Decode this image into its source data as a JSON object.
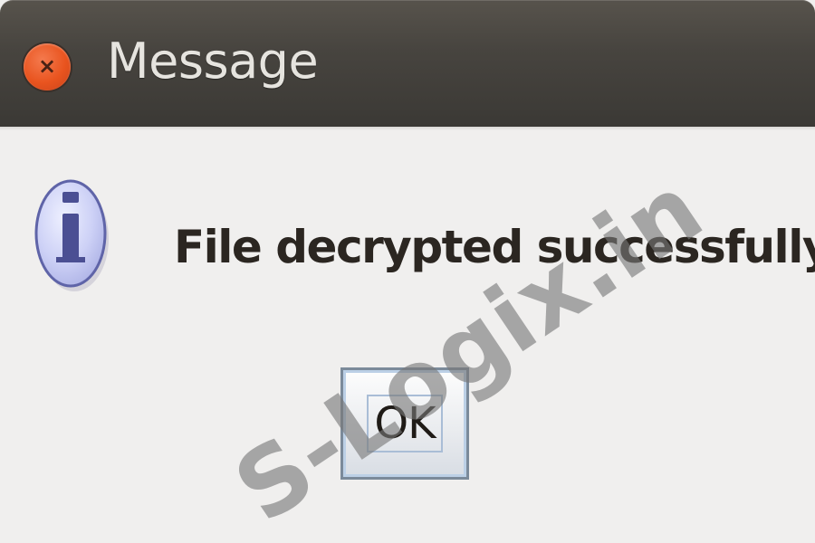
{
  "window": {
    "title": "Message",
    "close_glyph": "×",
    "colors": {
      "titlebar": "#47443f",
      "close_button": "#e9541f",
      "background": "#f0efee"
    }
  },
  "dialog": {
    "icon": "information-icon",
    "message": "File decrypted successfully.",
    "ok_label": "OK"
  },
  "watermark": {
    "text": "S-Logix.in"
  }
}
